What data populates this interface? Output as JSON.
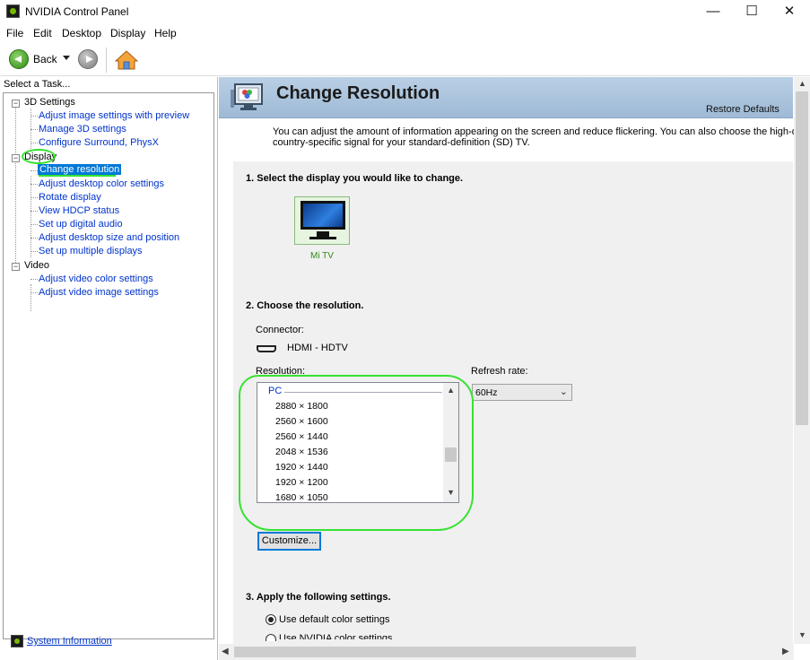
{
  "window": {
    "title": "NVIDIA Control Panel",
    "minimize": "—",
    "maximize": "☐",
    "close": "✕"
  },
  "menu": [
    "File",
    "Edit",
    "Desktop",
    "Display",
    "Help"
  ],
  "toolbar": {
    "back_label": "Back"
  },
  "left_panel": {
    "task_label": "Select a Task...",
    "tree": {
      "3d_settings": {
        "label": "3D Settings",
        "children": [
          "Adjust image settings with preview",
          "Manage 3D settings",
          "Configure Surround, PhysX"
        ]
      },
      "display": {
        "label": "Display",
        "children": [
          "Change resolution",
          "Adjust desktop color settings",
          "Rotate display",
          "View HDCP status",
          "Set up digital audio",
          "Adjust desktop size and position",
          "Set up multiple displays"
        ]
      },
      "video": {
        "label": "Video",
        "children": [
          "Adjust video color settings",
          "Adjust video image settings"
        ]
      }
    },
    "system_information": "System Information"
  },
  "page": {
    "title": "Change Resolution",
    "restore_defaults": "Restore Defaults",
    "intro_line1": "You can adjust the amount of information appearing on the screen and reduce flickering. You can also choose the high-definition (H",
    "intro_line2": "country-specific signal for your standard-definition (SD) TV.",
    "section1": "1. Select the display you would like to change.",
    "display_name": "Mi TV",
    "section2": "2. Choose the resolution.",
    "connector_label": "Connector:",
    "connector_value": "HDMI - HDTV",
    "resolution_label": "Resolution:",
    "resolution_group": "PC",
    "resolutions": [
      "2880 × 1800",
      "2560 × 1600",
      "2560 × 1440",
      "2048 × 1536",
      "1920 × 1440",
      "1920 × 1200",
      "1680 × 1050"
    ],
    "refresh_label": "Refresh rate:",
    "refresh_value": "60Hz",
    "customize_button": "Customize...",
    "section3": "3. Apply the following settings.",
    "radio_default": "Use default color settings",
    "radio_nvidia": "Use NVIDIA color settings"
  },
  "colors": {
    "selection": "#0078d7",
    "link": "#0033cc",
    "annotation": "#36e22f",
    "banner": "#b9cfe5",
    "nvidia_green": "#76b900"
  }
}
